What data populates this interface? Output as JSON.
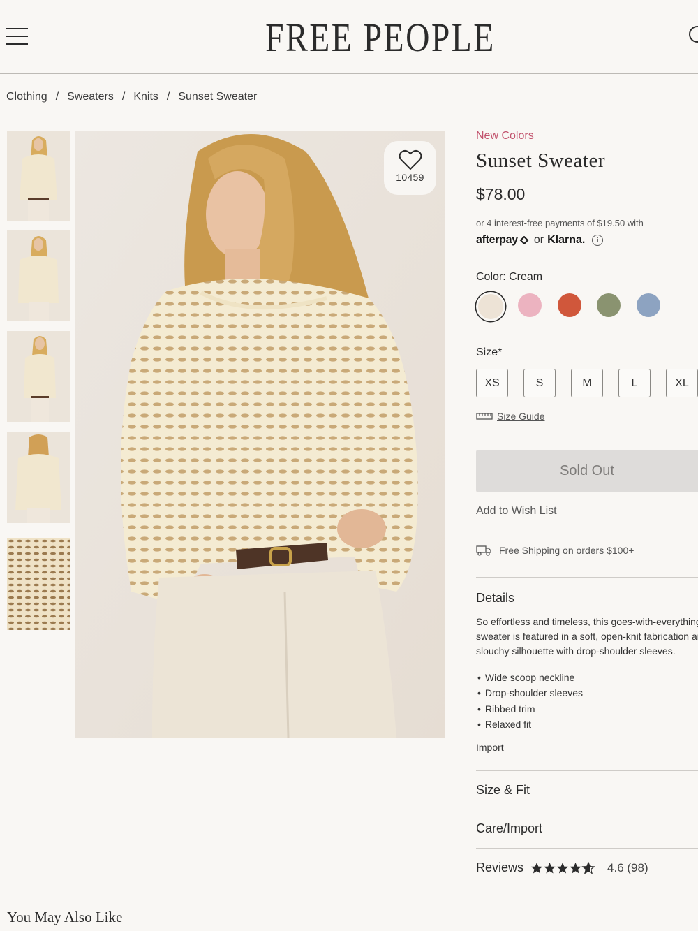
{
  "header": {
    "logo": "FREE PEOPLE",
    "menu_icon": "hamburger-menu-icon",
    "search_icon": "search-icon"
  },
  "breadcrumb": [
    "Clothing",
    "Sweaters",
    "Knits",
    "Sunset Sweater"
  ],
  "gallery": {
    "thumbnail_count": 5,
    "favorite_count": "10459",
    "favorite_icon": "heart-icon"
  },
  "product": {
    "badge": "New Colors",
    "title": "Sunset Sweater",
    "price": "$78.00",
    "installments": "or 4 interest-free payments of $19.50 with",
    "afterpay": "afterpay",
    "or": "or",
    "klarna": "Klarna.",
    "color_label": "Color: Cream",
    "colors": [
      {
        "name": "Cream",
        "hex": "#ede3d6",
        "selected": true
      },
      {
        "name": "Pink",
        "hex": "#ecb3c0"
      },
      {
        "name": "Red",
        "hex": "#d0573b"
      },
      {
        "name": "Green",
        "hex": "#8a9370"
      },
      {
        "name": "Blue",
        "hex": "#8da3c1"
      }
    ],
    "size_label": "Size*",
    "sizes": [
      "XS",
      "S",
      "M",
      "L",
      "XL"
    ],
    "size_guide": "Size Guide",
    "sold_out": "Sold Out",
    "wishlist": "Add to Wish List",
    "shipping": "Free Shipping on orders $100+"
  },
  "details": {
    "heading": "Details",
    "description_lines": [
      "So effortless and timeless, this goes-with-everything",
      "sweater is featured in a soft, open-knit fabrication and",
      "slouchy silhouette with drop-shoulder sleeves."
    ],
    "bullets": [
      "Wide scoop neckline",
      "Drop-shoulder sleeves",
      "Ribbed trim",
      "Relaxed fit"
    ],
    "import": "Import"
  },
  "accordions": {
    "size_fit": "Size & Fit",
    "care": "Care/Import",
    "reviews": "Reviews",
    "rating": 4.6,
    "rating_text": "4.6 (98)"
  },
  "recommendations": {
    "heading": "You May Also Like"
  },
  "colors": {
    "background": "#f9f7f4",
    "accent_pink": "#c2536d",
    "sold_out_bg": "#dedcda"
  }
}
